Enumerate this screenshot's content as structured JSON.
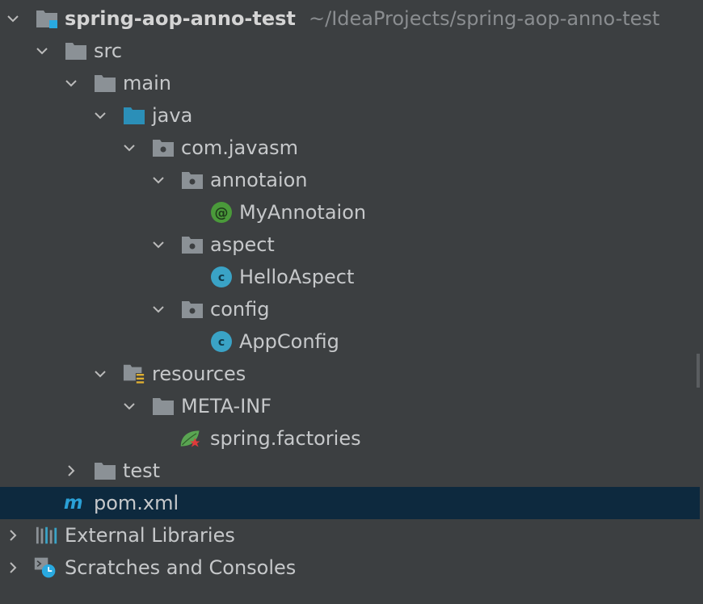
{
  "project": {
    "name": "spring-aop-anno-test",
    "path": "~/IdeaProjects/spring-aop-anno-test"
  },
  "tree": {
    "src": "src",
    "main": "main",
    "java": "java",
    "package": "com.javasm",
    "annotaion_pkg": "annotaion",
    "annotaion_file": "MyAnnotaion",
    "aspect_pkg": "aspect",
    "aspect_file": "HelloAspect",
    "config_pkg": "config",
    "config_file": "AppConfig",
    "resources": "resources",
    "metainf": "META-INF",
    "factories": "spring.factories",
    "test": "test",
    "pom": "pom.xml",
    "external": "External Libraries",
    "scratches": "Scratches and Consoles"
  },
  "colors": {
    "background": "#3c3f41",
    "selection": "#0d293e",
    "folder": "#8b9196",
    "source_folder": "#2b8fb8",
    "class_icon": "#3aa3c6",
    "annotation_icon": "#4a9a3a",
    "maven": "#2aa0d6"
  }
}
